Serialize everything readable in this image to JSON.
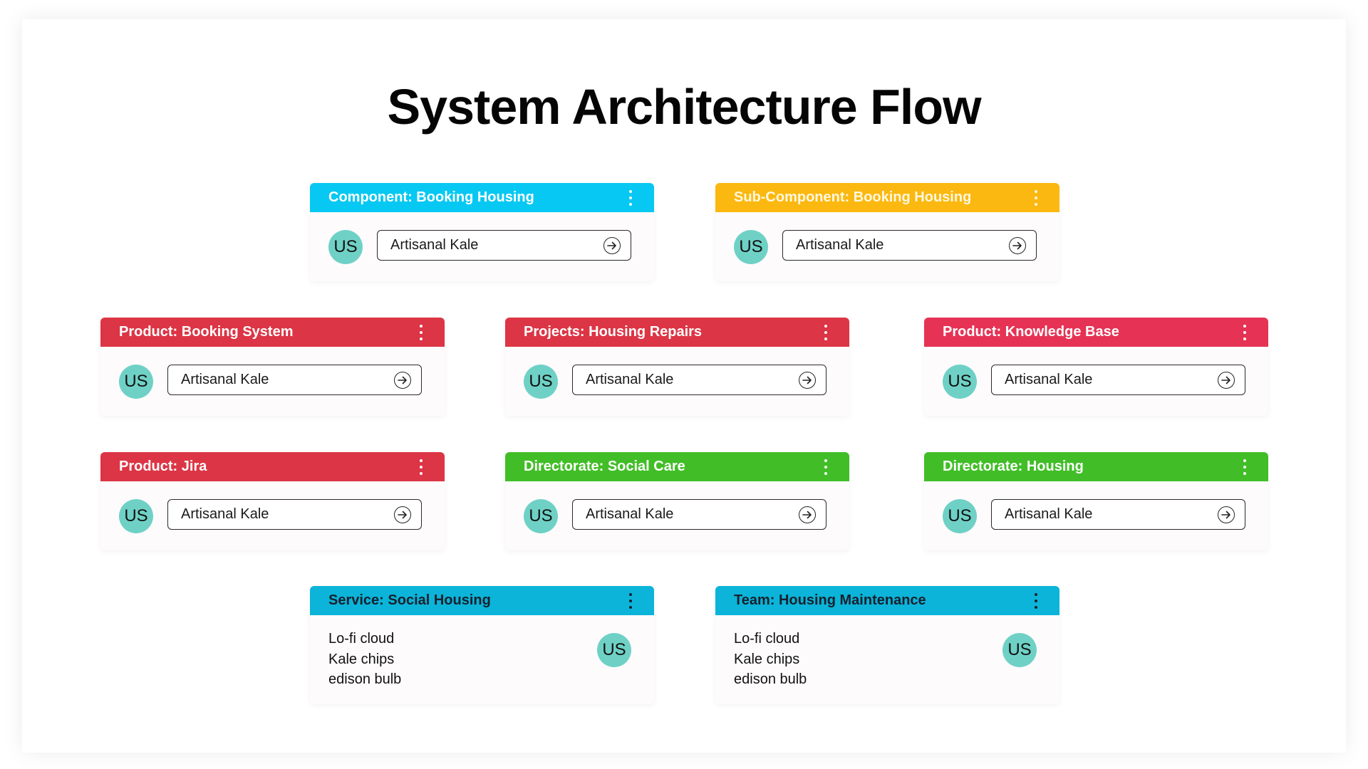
{
  "title": "System Architecture Flow",
  "colors": {
    "cyan": "#07c8f2",
    "gold": "#fbb810",
    "red": "#dc3545",
    "pink_red": "#e63355",
    "green": "#41be27",
    "teal_blue": "#0bb4d8",
    "avatar": "#6fd1c6"
  },
  "cards": [
    {
      "header": "Component: Booking Housing",
      "color": "#07c8f2",
      "avatar": "US",
      "field": "Artisanal Kale",
      "menu_icon": "kebab-menu-icon",
      "action_icon": "arrow-right-circle-icon"
    },
    {
      "header": "Sub-Component: Booking Housing",
      "color": "#fbb810",
      "avatar": "US",
      "field": "Artisanal Kale",
      "menu_icon": "kebab-menu-icon",
      "action_icon": "arrow-right-circle-icon"
    },
    {
      "header": "Product: Booking System",
      "color": "#dc3545",
      "avatar": "US",
      "field": "Artisanal Kale",
      "menu_icon": "kebab-menu-icon",
      "action_icon": "arrow-right-circle-icon"
    },
    {
      "header": "Projects: Housing Repairs",
      "color": "#dc3545",
      "avatar": "US",
      "field": "Artisanal Kale",
      "menu_icon": "kebab-menu-icon",
      "action_icon": "arrow-right-circle-icon"
    },
    {
      "header": "Product: Knowledge Base",
      "color": "#e63355",
      "avatar": "US",
      "field": "Artisanal Kale",
      "menu_icon": "kebab-menu-icon",
      "action_icon": "arrow-right-circle-icon"
    },
    {
      "header": "Product: Jira",
      "color": "#dc3545",
      "avatar": "US",
      "field": "Artisanal Kale",
      "menu_icon": "kebab-menu-icon",
      "action_icon": "arrow-right-circle-icon"
    },
    {
      "header": "Directorate: Social Care",
      "color": "#41be27",
      "avatar": "US",
      "field": "Artisanal Kale",
      "menu_icon": "kebab-menu-icon",
      "action_icon": "arrow-right-circle-icon"
    },
    {
      "header": "Directorate: Housing",
      "color": "#41be27",
      "avatar": "US",
      "field": "Artisanal Kale",
      "menu_icon": "kebab-menu-icon",
      "action_icon": "arrow-right-circle-icon"
    },
    {
      "header": "Service: Social Housing",
      "color": "#0bb4d8",
      "avatar": "US",
      "notes": [
        "Lo-fi cloud",
        "Kale chips",
        "edison bulb"
      ],
      "menu_icon": "kebab-menu-icon"
    },
    {
      "header": "Team: Housing Maintenance",
      "color": "#0bb4d8",
      "avatar": "US",
      "notes": [
        "Lo-fi cloud",
        "Kale chips",
        "edison bulb"
      ],
      "menu_icon": "kebab-menu-icon"
    }
  ]
}
